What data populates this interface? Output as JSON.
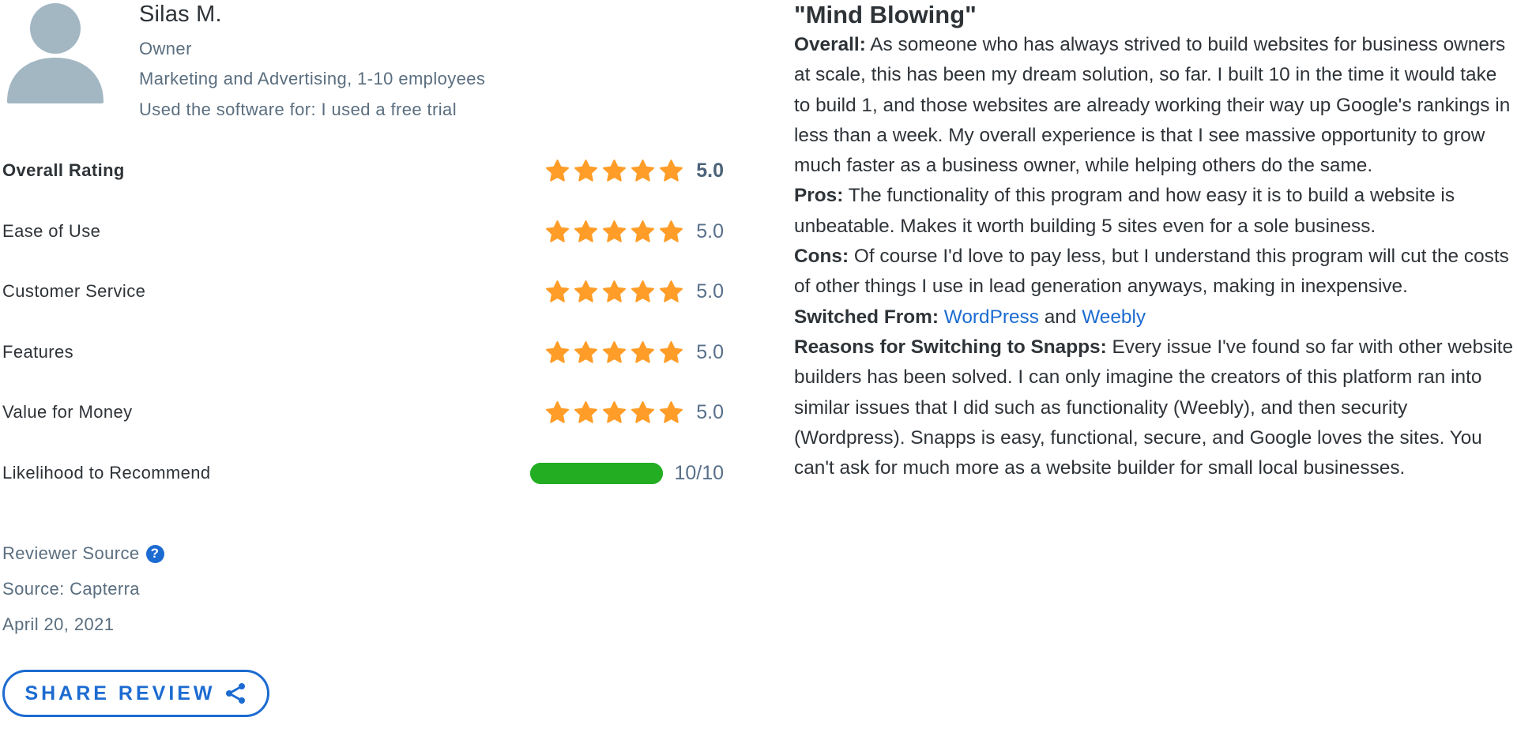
{
  "reviewer": {
    "avatar_icon": "user-silhouette-icon",
    "name": "Silas M.",
    "role": "Owner",
    "industry": "Marketing and Advertising",
    "company_size": "1-10 employees",
    "usage": "Used the software for: I used a free trial"
  },
  "ratings": [
    {
      "label": "Overall Rating",
      "stars": 5,
      "value": "5.0"
    },
    {
      "label": "Ease of Use",
      "stars": 5,
      "value": "5.0"
    },
    {
      "label": "Customer Service",
      "stars": 5,
      "value": "5.0"
    },
    {
      "label": "Features",
      "stars": 5,
      "value": "5.0"
    },
    {
      "label": "Value for Money",
      "stars": 5,
      "value": "5.0"
    }
  ],
  "recommend": {
    "label": "Likelihood to Recommend",
    "score": 10,
    "max": 10,
    "value_text": "10/10"
  },
  "source": {
    "reviewer_source_label": "Reviewer Source",
    "help_icon": "question-circle-icon",
    "source_text": "Source: Capterra",
    "date": "April 20, 2021"
  },
  "share": {
    "label": "SHARE REVIEW",
    "icon": "share-icon"
  },
  "colors": {
    "star": "#ff9d28",
    "recommend_bar": "#22ad23",
    "link": "#1c6bd1",
    "avatar": "#a3b7c3"
  },
  "review": {
    "title": "\"Mind Blowing\"",
    "overall_label": "Overall:",
    "overall_text": "As someone who has always strived to build websites for business owners at scale, this has been my dream solution, so far. I built 10 in the time it would take to build 1, and those websites are already working their way up Google's rankings in less than a week. My overall experience is that I see massive opportunity to grow much faster as a business owner, while helping others do the same.",
    "pros_label": "Pros:",
    "pros_text": "The functionality of this program and how easy it is to build a website is unbeatable. Makes it worth building 5 sites even for a sole business.",
    "cons_label": "Cons:",
    "cons_text": "Of course I'd love to pay less, but I understand this program will cut the costs of other things I use in lead generation anyways, making in inexpensive.",
    "switched_label": "Switched From:",
    "switched_from": [
      "WordPress",
      "Weebly"
    ],
    "switched_conj": "and",
    "reasons_label": "Reasons for Switching to Snapps:",
    "reasons_text": "Every issue I've found so far with other website builders has been solved. I can only imagine the creators of this platform ran into similar issues that I did such as functionality (Weebly), and then security (Wordpress). Snapps is easy, functional, secure, and Google loves the sites. You can't ask for much more as a website builder for small local businesses."
  }
}
